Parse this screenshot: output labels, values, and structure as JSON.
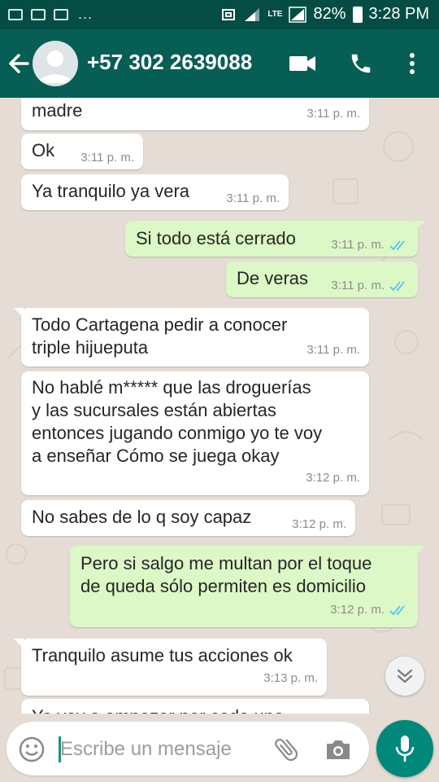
{
  "status_bar": {
    "battery_percent": "82%",
    "time": "3:28 PM",
    "network": "LTE",
    "overflow": "..."
  },
  "header": {
    "contact": "+57 302 2639088"
  },
  "messages": [
    {
      "dir": "in",
      "text": "madre",
      "time": "3:11 p. m."
    },
    {
      "dir": "in",
      "text": "Ok",
      "time": "3:11 p. m."
    },
    {
      "dir": "in",
      "text": "Ya tranquilo ya vera",
      "time": "3:11 p. m."
    },
    {
      "dir": "out",
      "text": "Si todo está cerrado",
      "time": "3:11 p. m."
    },
    {
      "dir": "out",
      "text": "De veras",
      "time": "3:11 p. m."
    },
    {
      "dir": "in",
      "text": "Todo Cartagena pedir a conocer\ntriple hijueputa",
      "time": "3:11 p. m."
    },
    {
      "dir": "in",
      "text": "No hablé m***** que las droguerías\ny las sucursales están abiertas\nentonces jugando conmigo yo te voy\na enseñar Cómo se juega okay",
      "time": "3:12 p. m."
    },
    {
      "dir": "in",
      "text": "No sabes de lo q soy capaz",
      "time": "3:12 p. m."
    },
    {
      "dir": "out",
      "text": "Pero si salgo me multan por el toque\nde queda sólo permiten es domicilio",
      "time": "3:12 p. m."
    },
    {
      "dir": "in",
      "text": "Tranquilo asume tus acciones ok",
      "time": "3:13 p. m."
    },
    {
      "dir": "in",
      "text": "Ya voy a empezar por cada uno",
      "time": ""
    }
  ],
  "input": {
    "placeholder": "Escribe un mensaje"
  },
  "colors": {
    "header": "#075e54",
    "status_bar": "#054d44",
    "outgoing_bubble": "#dcf8c6",
    "incoming_bubble": "#ffffff",
    "read_ticks": "#4fc3f7",
    "fab": "#00897b"
  },
  "icons": [
    "back-arrow-icon",
    "avatar-placeholder-icon",
    "video-call-icon",
    "phone-icon",
    "more-vert-icon",
    "double-check-icon",
    "chevron-double-down-icon",
    "emoji-icon",
    "paperclip-icon",
    "camera-icon",
    "mic-icon"
  ]
}
